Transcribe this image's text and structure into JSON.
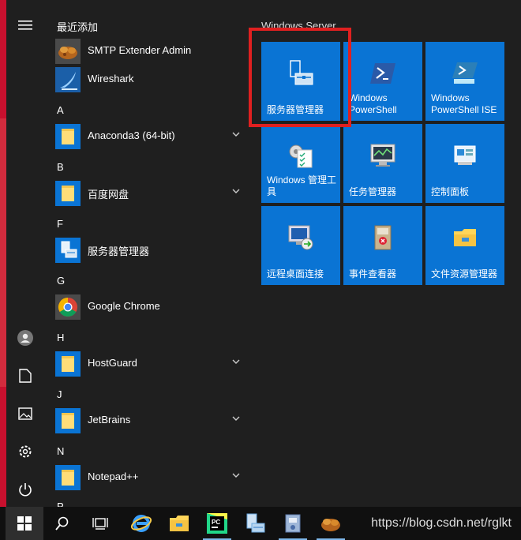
{
  "applist": {
    "recent_header": "最近添加",
    "recent": [
      {
        "label": "SMTP Extender Admin",
        "icon": "smtp-extender-icon"
      },
      {
        "label": "Wireshark",
        "icon": "wireshark-icon"
      }
    ],
    "sections": [
      {
        "letter": "A",
        "items": [
          {
            "label": "Anaconda3 (64-bit)",
            "icon": "folder-icon",
            "expandable": true
          }
        ]
      },
      {
        "letter": "B",
        "items": [
          {
            "label": "百度网盘",
            "icon": "folder-icon",
            "expandable": true
          }
        ]
      },
      {
        "letter": "F",
        "items": [
          {
            "label": "服务器管理器",
            "icon": "server-manager-icon",
            "expandable": false
          }
        ]
      },
      {
        "letter": "G",
        "items": [
          {
            "label": "Google Chrome",
            "icon": "chrome-icon",
            "expandable": false
          }
        ]
      },
      {
        "letter": "H",
        "items": [
          {
            "label": "HostGuard",
            "icon": "folder-icon",
            "expandable": true
          }
        ]
      },
      {
        "letter": "J",
        "items": [
          {
            "label": "JetBrains",
            "icon": "folder-icon",
            "expandable": true
          }
        ]
      },
      {
        "letter": "N",
        "items": [
          {
            "label": "Notepad++",
            "icon": "folder-icon",
            "expandable": true
          }
        ]
      },
      {
        "letter": "P",
        "items": []
      }
    ]
  },
  "tiles": {
    "group_title": "Windows Server",
    "items": [
      {
        "label": "服务器管理器",
        "icon": "server-manager-icon",
        "highlighted": true
      },
      {
        "label": "Windows PowerShell",
        "icon": "powershell-icon"
      },
      {
        "label": "Windows PowerShell ISE",
        "icon": "powershell-ise-icon"
      },
      {
        "label": "Windows 管理工具",
        "icon": "admin-tools-icon"
      },
      {
        "label": "任务管理器",
        "icon": "task-manager-icon"
      },
      {
        "label": "控制面板",
        "icon": "control-panel-icon"
      },
      {
        "label": "远程桌面连接",
        "icon": "remote-desktop-icon"
      },
      {
        "label": "事件查看器",
        "icon": "event-viewer-icon"
      },
      {
        "label": "文件资源管理器",
        "icon": "file-explorer-icon"
      }
    ]
  },
  "rail": [
    "hamburger-icon",
    "user-icon",
    "document-icon",
    "pictures-icon",
    "settings-icon",
    "power-icon"
  ],
  "taskbar": {
    "buttons": [
      "start-icon",
      "search-icon",
      "task-view-icon",
      "internet-explorer-icon",
      "file-explorer-icon",
      "pycharm-icon",
      "server-manager-icon",
      "app-icon",
      "smtp-extender-icon"
    ],
    "watermark": "https://blog.csdn.net/rglkt"
  },
  "colors": {
    "tile": "#0a74d4",
    "accent_red": "#e02020",
    "desktop_red": "#c8102e"
  }
}
